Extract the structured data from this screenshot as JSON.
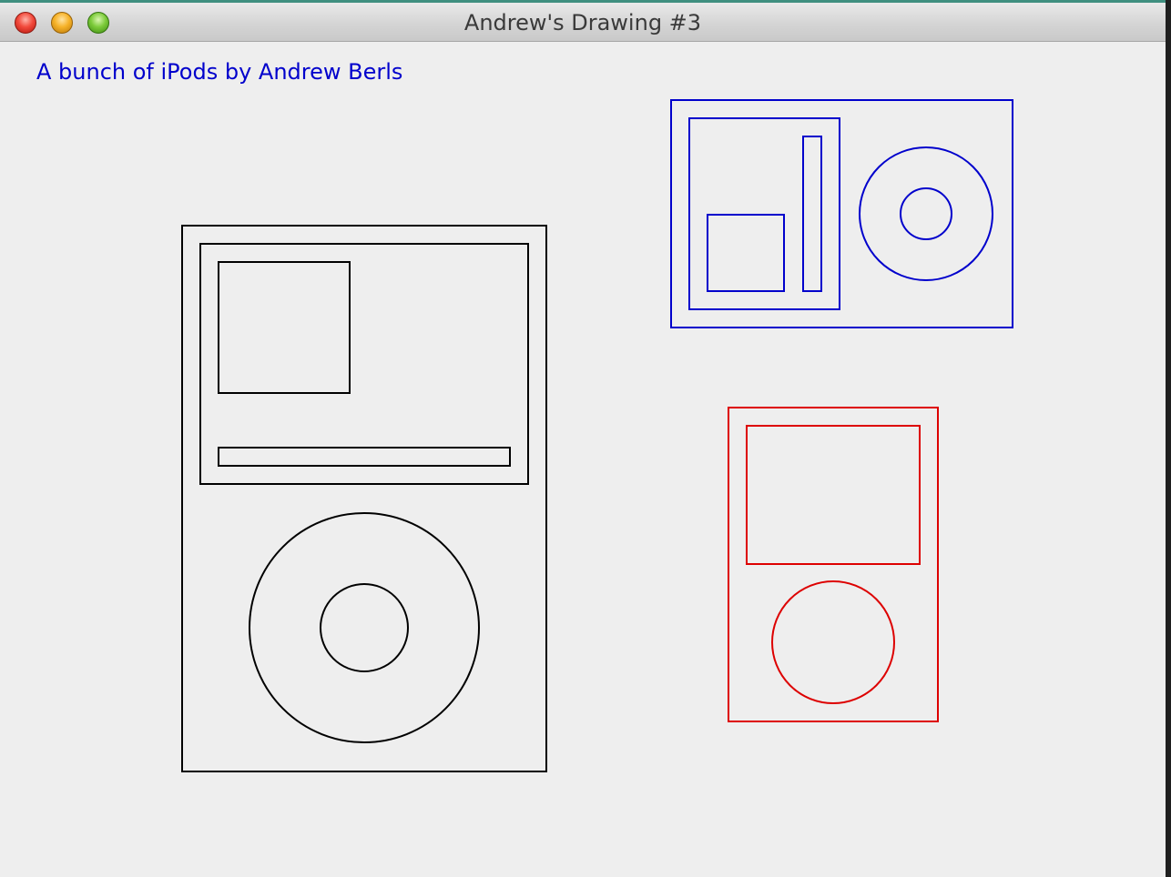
{
  "window": {
    "title": "Andrew's Drawing #3"
  },
  "caption": "A bunch of iPods by Andrew Berls",
  "colors": {
    "caption": "#0000cc",
    "large_ipod": "#000000",
    "blue_ipod": "#0000cc",
    "red_ipod": "#dd0000"
  },
  "icons": {
    "close": "close-icon",
    "minimize": "minimize-icon",
    "zoom": "zoom-icon"
  }
}
